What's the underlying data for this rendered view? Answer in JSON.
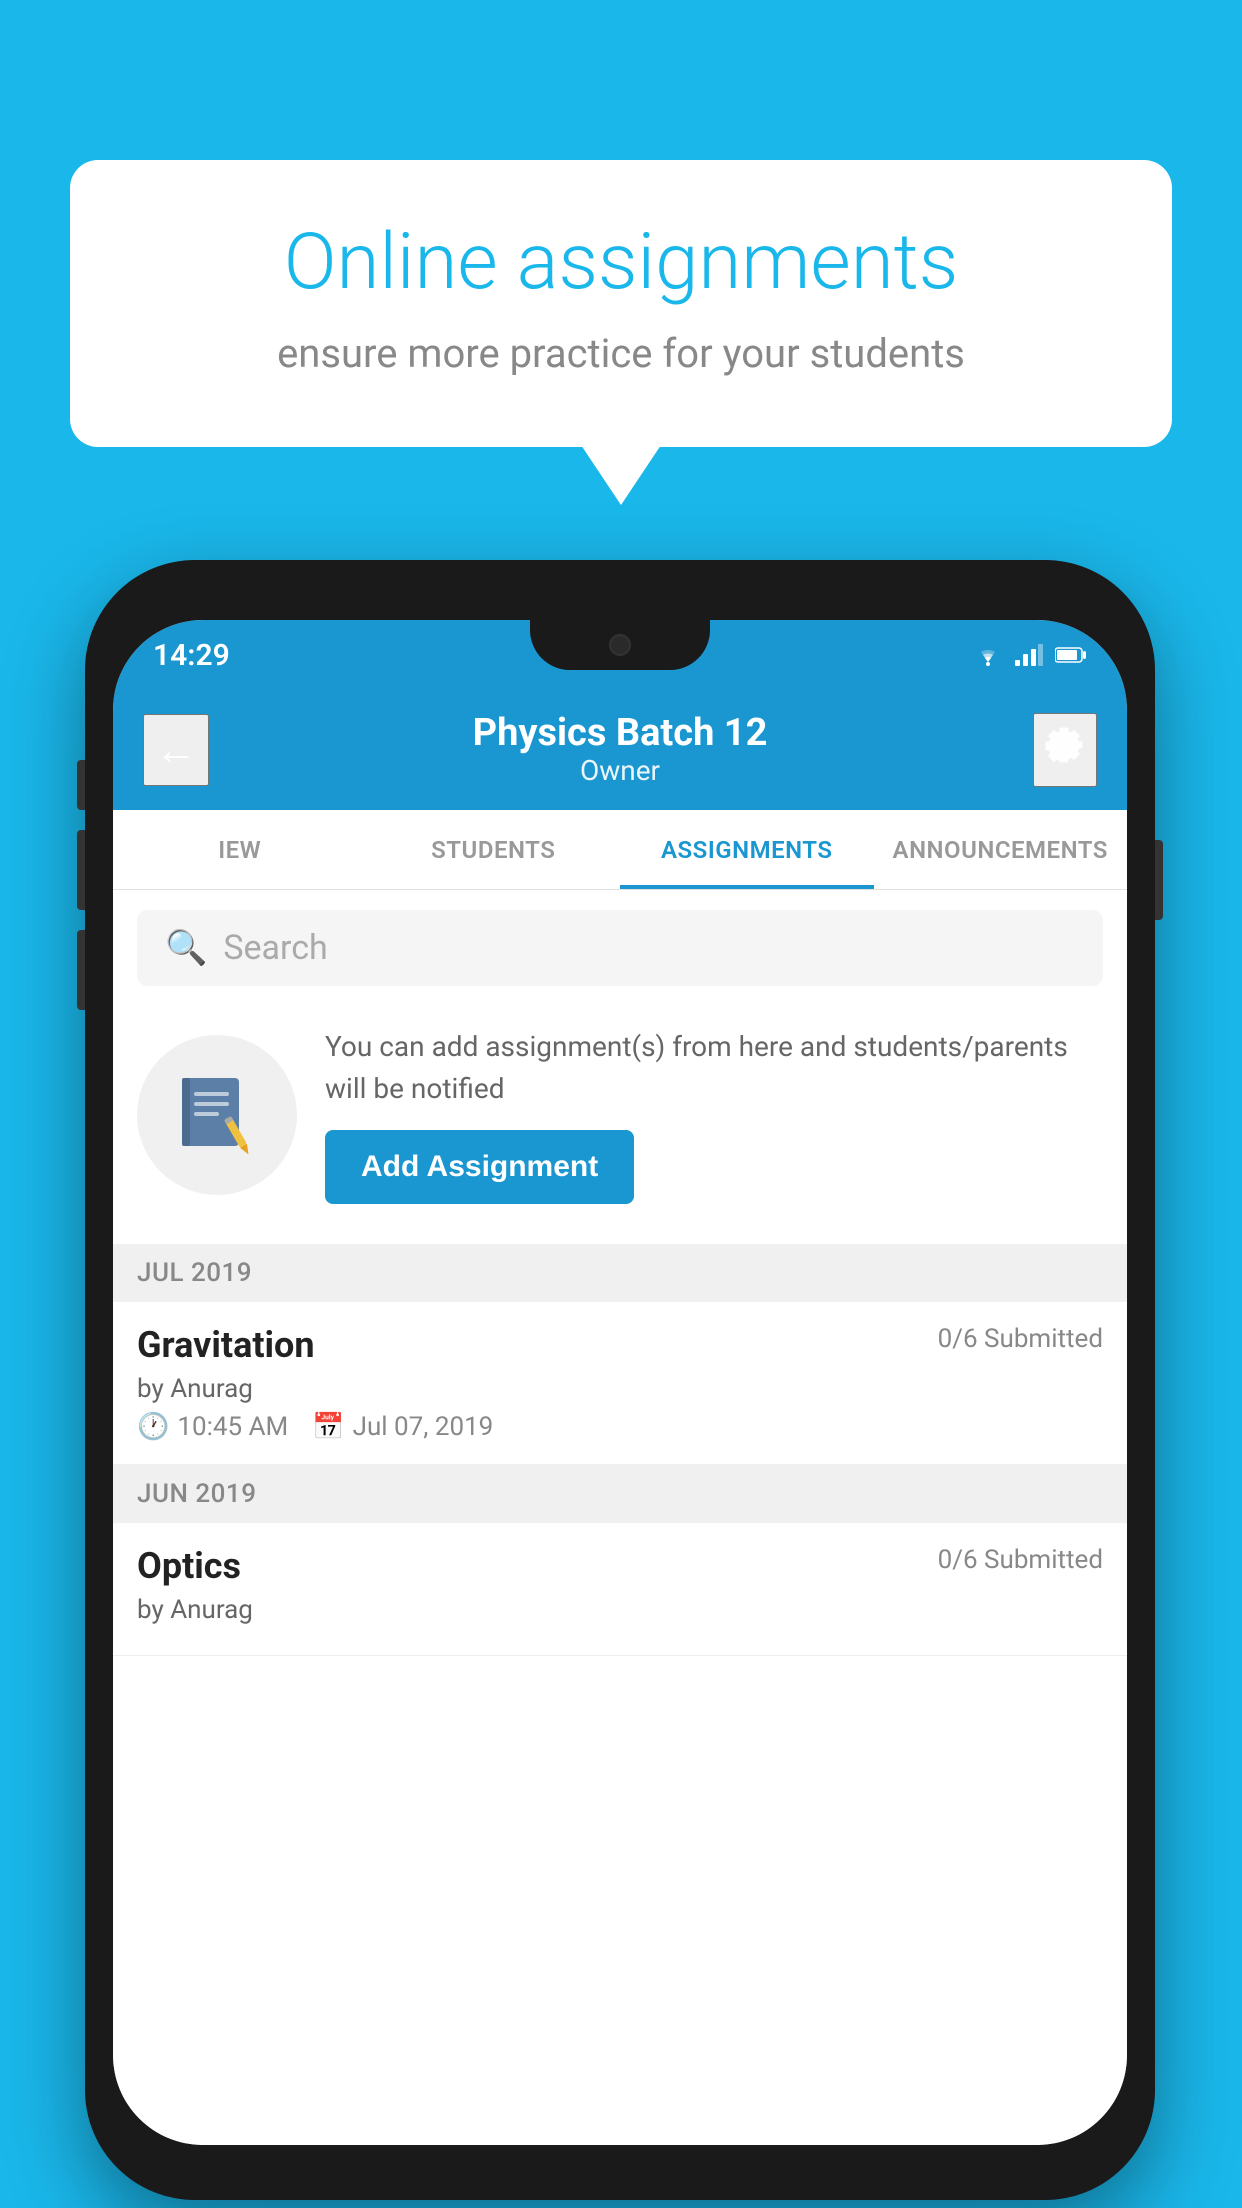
{
  "background_color": "#1ab7ea",
  "speech_bubble": {
    "title": "Online assignments",
    "subtitle": "ensure more practice for your students"
  },
  "status_bar": {
    "time": "14:29",
    "wifi": "▾",
    "signal": "▲",
    "battery": "▐"
  },
  "header": {
    "back_label": "←",
    "title": "Physics Batch 12",
    "subtitle": "Owner",
    "settings_label": "⚙"
  },
  "tabs": [
    {
      "id": "iew",
      "label": "IEW",
      "active": false
    },
    {
      "id": "students",
      "label": "STUDENTS",
      "active": false
    },
    {
      "id": "assignments",
      "label": "ASSIGNMENTS",
      "active": true
    },
    {
      "id": "announcements",
      "label": "ANNOUNCEMENTS",
      "active": false
    }
  ],
  "search": {
    "placeholder": "Search"
  },
  "promo": {
    "description": "You can add assignment(s) from here and students/parents will be notified",
    "button_label": "Add Assignment"
  },
  "sections": [
    {
      "month_label": "JUL 2019",
      "assignments": [
        {
          "title": "Gravitation",
          "submitted": "0/6 Submitted",
          "by": "by Anurag",
          "time": "10:45 AM",
          "date": "Jul 07, 2019"
        }
      ]
    },
    {
      "month_label": "JUN 2019",
      "assignments": [
        {
          "title": "Optics",
          "submitted": "0/6 Submitted",
          "by": "by Anurag",
          "time": "",
          "date": ""
        }
      ]
    }
  ]
}
